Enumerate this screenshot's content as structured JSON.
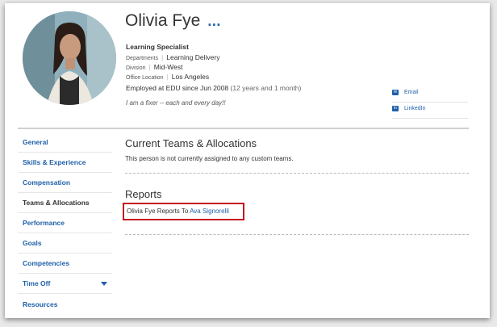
{
  "profile": {
    "name": "Olivia Fye",
    "more_label": "...",
    "job_title": "Learning Specialist",
    "departments_label": "Departments",
    "departments_value": "Learning Delivery",
    "division_label": "Division",
    "division_value": "Mid-West",
    "office_label": "Office Location",
    "office_value": "Los Angeles",
    "employed_text": "Employed at EDU since Jun 2008",
    "employed_duration": "(12 years and 1 month)",
    "quote": "I am a fixer -- each and every day!!"
  },
  "contacts": {
    "email_label": "Email",
    "email_icon": "envelope-icon",
    "linkedin_label": "LinkedIn",
    "linkedin_icon": "linkedin-icon"
  },
  "sidebar": {
    "items": [
      {
        "label": "General"
      },
      {
        "label": "Skills & Experience"
      },
      {
        "label": "Compensation"
      },
      {
        "label": "Teams & Allocations"
      },
      {
        "label": "Performance"
      },
      {
        "label": "Goals"
      },
      {
        "label": "Competencies"
      },
      {
        "label": "Time Off"
      },
      {
        "label": "Resources"
      }
    ]
  },
  "teams": {
    "title": "Current Teams & Allocations",
    "message": "This person is not currently assigned to any custom teams."
  },
  "reports": {
    "title": "Reports",
    "prefix": "Olivia Fye Reports To",
    "manager": "Ava Signorelli"
  },
  "colors": {
    "link": "#1f5fa8",
    "highlight": "#c4161c"
  }
}
